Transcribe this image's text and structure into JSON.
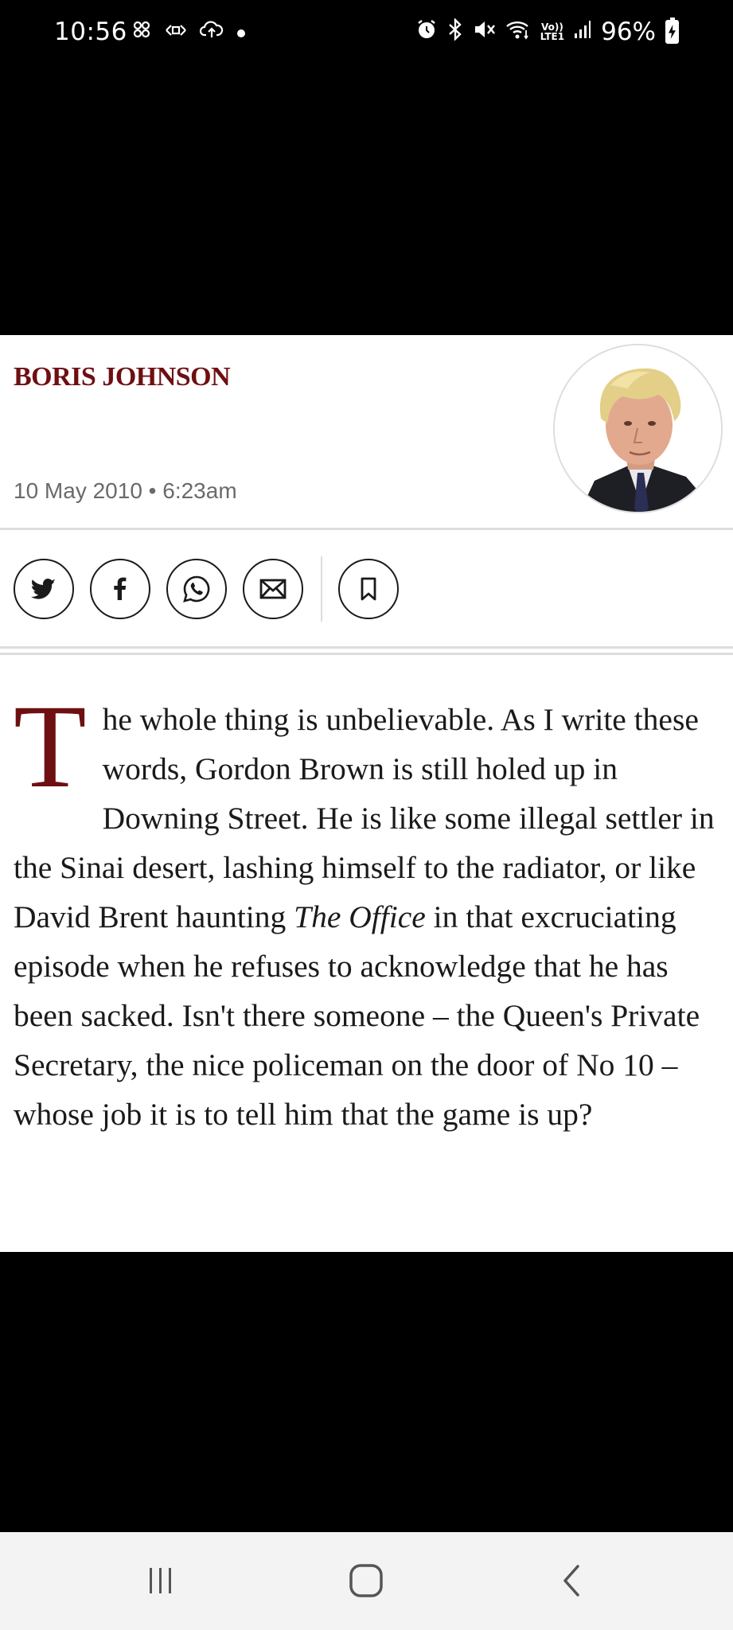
{
  "status_bar": {
    "time": "10:56",
    "left_icons": [
      "pinwheel-icon",
      "cast-icon",
      "cloud-upload-icon",
      "dot-icon"
    ],
    "right_icons": [
      "alarm-icon",
      "bluetooth-icon",
      "mute-icon",
      "wifi-icon",
      "volte-icon",
      "signal-icon"
    ],
    "volte_top": "Vo))",
    "volte_bottom": "LTE1",
    "battery": "96%"
  },
  "article": {
    "author": "BORIS JOHNSON",
    "date": "10 May 2010 • 6:23am",
    "share_buttons": [
      "twitter-icon",
      "facebook-icon",
      "whatsapp-icon",
      "email-icon",
      "bookmark-icon"
    ],
    "drop_cap": "T",
    "body_part1": "he whole thing is unbelievable. As I write these words, Gordon Brown is still holed up in Downing Street. He is like some illegal settler in the Sinai desert, lashing himself to the radiator, or like David Brent haunting ",
    "body_italic": "The Office",
    "body_part2": " in that excruciating episode when he refuses to acknowledge that he has been sacked. Isn't there someone – the Queen's Private Secretary, the nice policeman on the door of No 10 – whose job it is to tell him that the game is up?"
  },
  "nav_bar": {
    "buttons": [
      "recent-apps-icon",
      "home-icon",
      "back-icon"
    ]
  },
  "colors": {
    "accent": "#6e0f12",
    "text": "#1a1a1a",
    "muted": "#6a6a6a"
  }
}
